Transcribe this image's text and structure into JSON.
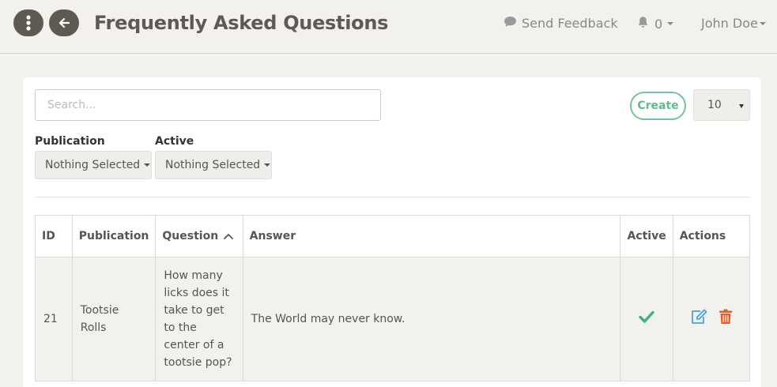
{
  "header": {
    "title": "Frequently Asked Questions",
    "feedback_label": "Send Feedback",
    "notification_count": "0",
    "user_name": "John Doe"
  },
  "toolbar": {
    "search_placeholder": "Search...",
    "create_label": "Create",
    "page_size": "10"
  },
  "filters": {
    "publication_label": "Publication",
    "publication_value": "Nothing Selected",
    "active_label": "Active",
    "active_value": "Nothing Selected"
  },
  "table": {
    "headers": {
      "id": "ID",
      "publication": "Publication",
      "question": "Question",
      "answer": "Answer",
      "active": "Active",
      "actions": "Actions"
    },
    "rows": [
      {
        "id": "21",
        "publication": "Tootsie Rolls",
        "question": "How many licks does it take to get to the center of a tootsie pop?",
        "answer": "The World may never know.",
        "active": true
      }
    ]
  },
  "colors": {
    "header_button": "#5d5a52",
    "create_accent": "#74c49a",
    "active_check": "#3db37a",
    "edit_icon": "#4aa3d8",
    "delete_icon": "#ee5a24"
  },
  "icons": [
    "menu-dots-icon",
    "back-arrow-icon",
    "chat-bubble-icon",
    "bell-icon",
    "sort-up-icon",
    "check-icon",
    "edit-icon",
    "trash-icon"
  ]
}
